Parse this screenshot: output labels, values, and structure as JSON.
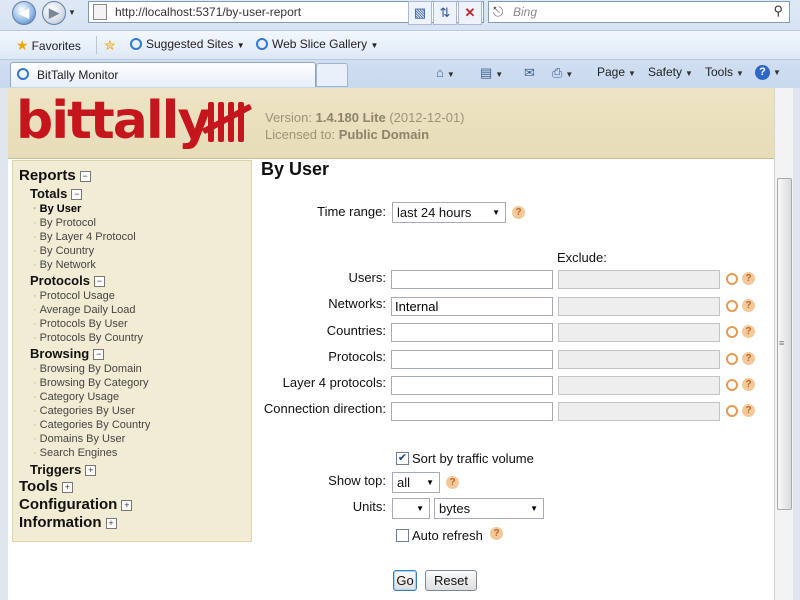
{
  "browser": {
    "url": "http://localhost:5371/by-user-report",
    "search_placeholder": "Bing",
    "favorites_label": "Favorites",
    "suggested_sites": "Suggested Sites",
    "web_slice_gallery": "Web Slice Gallery",
    "tab_title": "BitTally Monitor",
    "cmd_page": "Page",
    "cmd_safety": "Safety",
    "cmd_tools": "Tools"
  },
  "header": {
    "logo_text": "bittally",
    "version_label": "Version:",
    "version": "1.4.180 Lite",
    "version_date": "(2012-12-01)",
    "licensed_label": "Licensed to:",
    "licensee": "Public Domain"
  },
  "sidebar": {
    "reports": "Reports",
    "totals": "Totals",
    "totals_items": [
      "By User",
      "By Protocol",
      "By Layer 4 Protocol",
      "By Country",
      "By Network"
    ],
    "protocols": "Protocols",
    "protocols_items": [
      "Protocol Usage",
      "Average Daily Load",
      "Protocols By User",
      "Protocols By Country"
    ],
    "browsing": "Browsing",
    "browsing_items": [
      "Browsing By Domain",
      "Browsing By Category",
      "Category Usage",
      "Categories By User",
      "Categories By Country",
      "Domains By User",
      "Search Engines"
    ],
    "triggers": "Triggers",
    "tools": "Tools",
    "configuration": "Configuration",
    "information": "Information"
  },
  "form": {
    "title": "By User",
    "time_range_label": "Time range:",
    "time_range_value": "last 24 hours",
    "exclude_label": "Exclude:",
    "fields": [
      {
        "label": "Users:",
        "value": ""
      },
      {
        "label": "Networks:",
        "value": "Internal"
      },
      {
        "label": "Countries:",
        "value": ""
      },
      {
        "label": "Protocols:",
        "value": ""
      },
      {
        "label": "Layer 4 protocols:",
        "value": ""
      },
      {
        "label": "Connection direction:",
        "value": ""
      }
    ],
    "sort_label": "Sort by traffic volume",
    "sort_checked": true,
    "show_top_label": "Show top:",
    "show_top_value": "all",
    "units_label": "Units:",
    "units_prefix_value": "",
    "units_value": "bytes",
    "auto_refresh_label": "Auto refresh",
    "auto_refresh_checked": false,
    "go_label": "Go",
    "reset_label": "Reset"
  }
}
